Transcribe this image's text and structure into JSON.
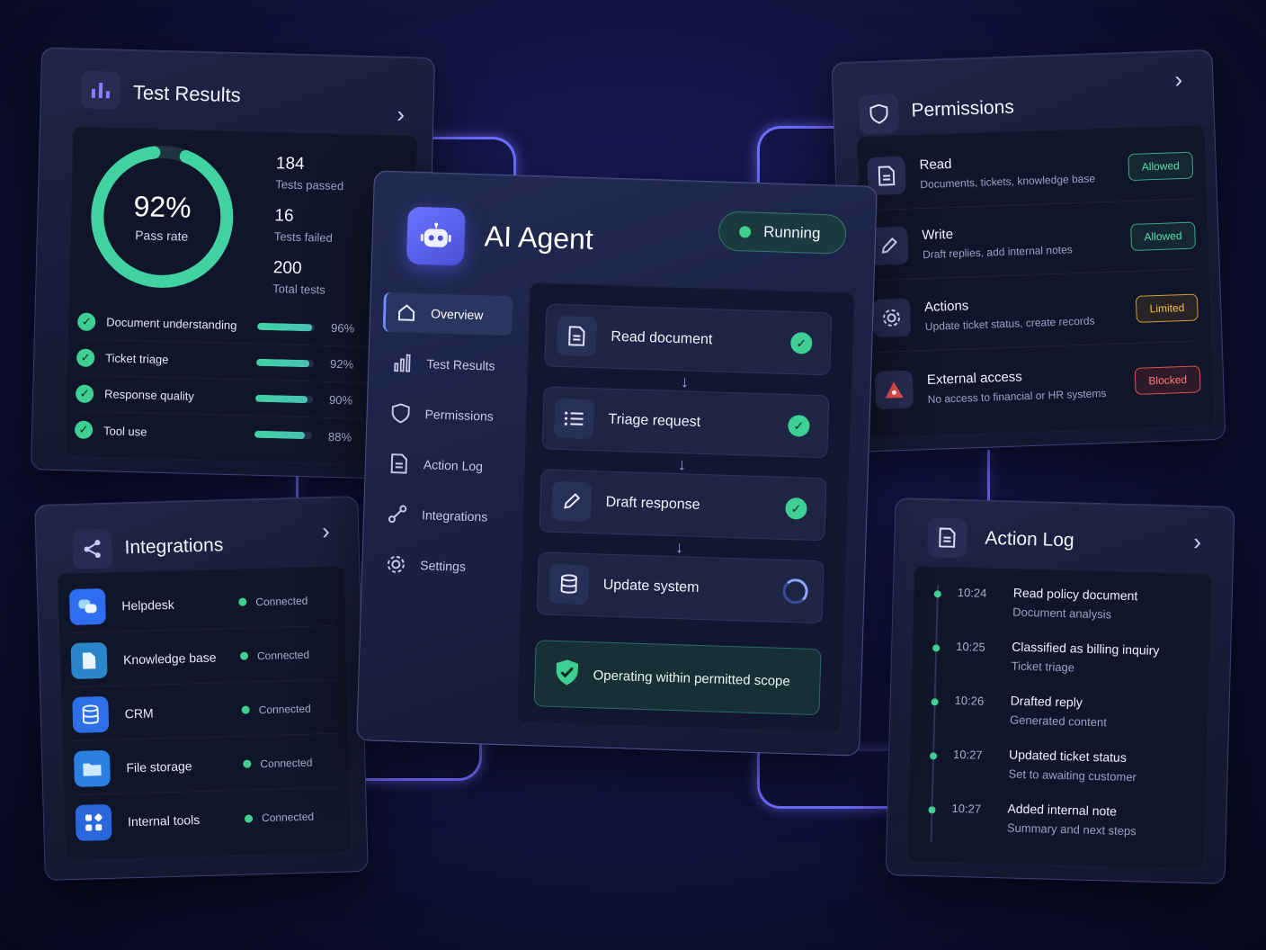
{
  "test_results": {
    "title": "Test Results",
    "pass_rate_value": "92%",
    "pass_rate_label": "Pass rate",
    "pass_rate_fraction": 0.92,
    "stats": [
      {
        "value": "184",
        "label": "Tests passed"
      },
      {
        "value": "16",
        "label": "Tests failed"
      },
      {
        "value": "200",
        "label": "Total tests"
      }
    ],
    "rows": [
      {
        "name": "Document understanding",
        "pct": "96%",
        "fill": 0.96
      },
      {
        "name": "Ticket triage",
        "pct": "92%",
        "fill": 0.92
      },
      {
        "name": "Response quality",
        "pct": "90%",
        "fill": 0.9
      },
      {
        "name": "Tool use",
        "pct": "88%",
        "fill": 0.88
      }
    ]
  },
  "integrations": {
    "title": "Integrations",
    "items": [
      {
        "name": "Helpdesk",
        "status": "Connected",
        "color": "#2f6df0"
      },
      {
        "name": "Knowledge base",
        "status": "Connected",
        "color": "#2b86c9"
      },
      {
        "name": "CRM",
        "status": "Connected",
        "color": "#2c6fe6"
      },
      {
        "name": "File storage",
        "status": "Connected",
        "color": "#2a7fe0"
      },
      {
        "name": "Internal tools",
        "status": "Connected",
        "color": "#2a66dc"
      }
    ]
  },
  "agent": {
    "title": "AI Agent",
    "status": "Running",
    "nav": [
      {
        "label": "Overview",
        "icon": "home-icon"
      },
      {
        "label": "Test Results",
        "icon": "bar-chart-icon"
      },
      {
        "label": "Permissions",
        "icon": "shield-icon"
      },
      {
        "label": "Action Log",
        "icon": "document-icon"
      },
      {
        "label": "Integrations",
        "icon": "connection-icon"
      },
      {
        "label": "Settings",
        "icon": "gear-icon"
      }
    ],
    "steps": [
      {
        "label": "Read document",
        "state": "done"
      },
      {
        "label": "Triage request",
        "state": "done"
      },
      {
        "label": "Draft response",
        "state": "done"
      },
      {
        "label": "Update system",
        "state": "in-progress"
      }
    ],
    "scope_message": "Operating within permitted scope"
  },
  "permissions": {
    "title": "Permissions",
    "items": [
      {
        "title": "Read",
        "desc": "Documents, tickets, knowledge base",
        "badge": "Allowed",
        "level": "allowed"
      },
      {
        "title": "Write",
        "desc": "Draft replies, add internal notes",
        "badge": "Allowed",
        "level": "allowed"
      },
      {
        "title": "Actions",
        "desc": "Update ticket status, create records",
        "badge": "Limited",
        "level": "limited"
      },
      {
        "title": "External access",
        "desc": "No access to financial or HR systems",
        "badge": "Blocked",
        "level": "blocked"
      }
    ]
  },
  "action_log": {
    "title": "Action Log",
    "entries": [
      {
        "time": "10:24",
        "title": "Read policy document",
        "sub": "Document analysis"
      },
      {
        "time": "10:25",
        "title": "Classified as billing inquiry",
        "sub": "Ticket triage"
      },
      {
        "time": "10:26",
        "title": "Drafted reply",
        "sub": "Generated content"
      },
      {
        "time": "10:27",
        "title": "Updated ticket status",
        "sub": "Set to awaiting customer"
      },
      {
        "time": "10:27",
        "title": "Added internal note",
        "sub": "Summary and next steps"
      }
    ]
  },
  "colors": {
    "accent": "#6f6cff",
    "success": "#3ecf93",
    "warning": "#f3c04c",
    "danger": "#ff7a70"
  }
}
